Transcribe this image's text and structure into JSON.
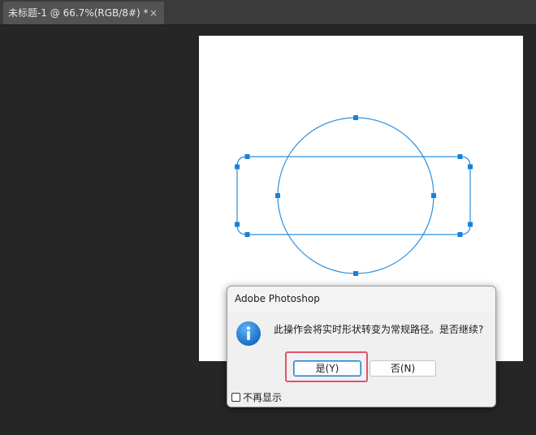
{
  "document_tab": {
    "title": "未标题-1 @ 66.7%(RGB/8#) *",
    "close_glyph": "×"
  },
  "colors": {
    "path_stroke": "#2b8fe0",
    "anchor_fill": "#1b80d8",
    "info_icon": "#1a7fd4",
    "highlight": "#e0526c"
  },
  "dialog": {
    "title": "Adobe Photoshop",
    "icon": "info-icon",
    "message": "此操作会将实时形状转变为常规路径。是否继续?",
    "yes_label": "是(Y)",
    "no_label": "否(N)",
    "dont_show_label": "不再显示",
    "dont_show_checked": false
  }
}
